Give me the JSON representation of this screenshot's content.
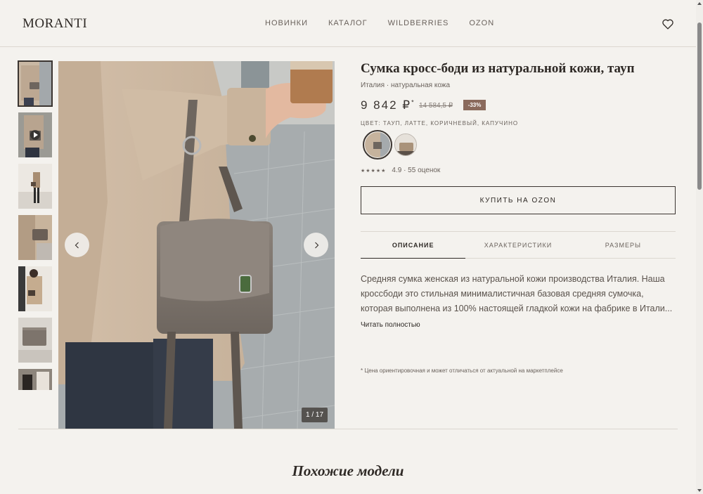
{
  "header": {
    "logo": "MORANTI",
    "nav": [
      "НОВИНКИ",
      "КАТАЛОГ",
      "WILDBERRIES",
      "OZON"
    ],
    "favorites_icon": "heart-icon"
  },
  "gallery": {
    "counter": "1 / 17",
    "prev_icon": "chevron-left-icon",
    "next_icon": "chevron-right-icon",
    "thumbnail_count_visible": 7,
    "video_thumb_icon": "play-icon"
  },
  "product": {
    "title": "Сумка кросс-боди из натуральной кожи, тауп",
    "subtitle": "Италия · натуральная кожа",
    "price": "9 842 ₽",
    "price_marker": "*",
    "old_price": "14 584,5 ₽",
    "discount": "-33%",
    "colors_label": "ЦВЕТ: ТАУП, ЛАТТЕ, КОРИЧНЕВЫЙ, КАПУЧИНО",
    "stars": "★★★★★",
    "rating_text": "4.9 · 55 оценок",
    "buy_label": "КУПИТЬ НА OZON"
  },
  "tabs": [
    "ОПИСАНИЕ",
    "ХАРАКТЕРИСТИКИ",
    "РАЗМЕРЫ"
  ],
  "description": {
    "text": "Средняя сумка женская из натуральной кожи производства Италия. Наша кроссбоди это стильная минималистичная базовая средняя сумочка, которая выполнена из 100% настоящей гладкой кожи на фабрике в Итали...",
    "read_more": "Читать полностью",
    "footnote": "* Цена ориентировочная и может отличаться от актуальной на маркетплейсе"
  },
  "related": {
    "title": "Похожие модели"
  },
  "colors": {
    "accent": "#8a6a5c",
    "text": "#2e2925",
    "background": "#f4f2ee"
  }
}
